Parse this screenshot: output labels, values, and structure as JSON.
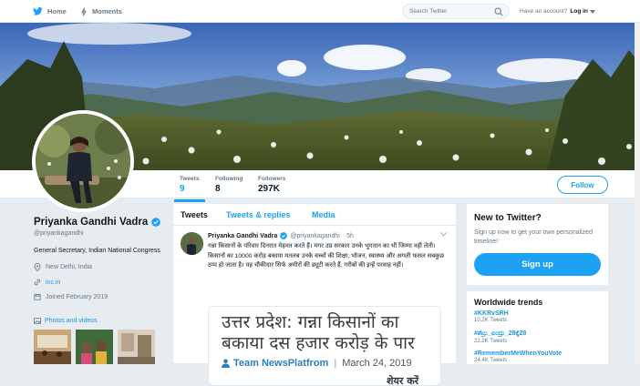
{
  "nav": {
    "home_label": "Home",
    "moments_label": "Moments",
    "search_placeholder": "Search Twitter",
    "have_account": "Have an account?",
    "login_label": "Log in"
  },
  "stats": [
    {
      "label": "Tweets",
      "value": "9"
    },
    {
      "label": "Following",
      "value": "8"
    },
    {
      "label": "Followers",
      "value": "297K"
    }
  ],
  "follow_label": "Follow",
  "profile": {
    "name": "Priyanka Gandhi Vadra",
    "handle": "@priyankagandhi",
    "bio": "General Secretary, Indian National Congress",
    "location": "New Delhi, India",
    "website": "inc.in",
    "joined": "Joined February 2019",
    "photos_label": "Photos and videos"
  },
  "timeline": {
    "tabs": [
      "Tweets",
      "Tweets & replies",
      "Media"
    ],
    "tweet": {
      "author": "Priyanka Gandhi Vadra",
      "handle": "@priyankagandhi",
      "time": "· 5h",
      "text": "गन्ना किसानों के परिवार दिनरात मेहनत करते हैं। मगर उप्र सरकार उनके भुगतान का भी जिम्मा नहीं लेती। किसानों का 10000 करोड़ बकाया मतलब उनके बच्चों की शिक्षा, भोजन, स्वास्थ्य और अगली फसल सबकुछ ठप्प हो जाता है। यह चौकीदार सिर्फ अमीरों की ड्यूटी करते हैं, गरीबों की इन्हें परवाह नहीं।",
      "card": {
        "headline": "उत्तर प्रदेश: गन्ना किसानों का बकाया दस हजार करोड़ के पार",
        "source": "Team NewsPlatfrom",
        "separator": "|",
        "date": "March 24, 2019",
        "share": "शेयर करें"
      }
    }
  },
  "sidebar": {
    "new_title": "New to Twitter?",
    "new_text": "Sign up now to get your own personalized timeline!",
    "signup_label": "Sign up",
    "trends_title": "Worldwide trends",
    "trends": [
      {
        "tag": "#KKRvSRH",
        "count": "10.2K Tweets"
      },
      {
        "tag": "#ಶೆಟ್ರು_ಐಂದ್ರು_28ಕ್ಕೆ28",
        "count": "22.2K Tweets"
      },
      {
        "tag": "#RememberMeWhenYouVote",
        "count": "24.4K Tweets"
      }
    ]
  },
  "colors": {
    "accent": "#1da1f2",
    "link": "#1b95e0",
    "background": "#e6ecf0"
  }
}
